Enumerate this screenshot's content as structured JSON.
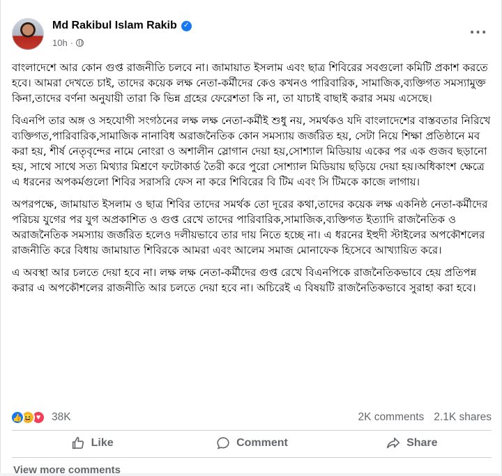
{
  "post": {
    "author_name": "Md Rakibul Islam Rakib",
    "timestamp": "10h",
    "audience_icon": "globe-icon",
    "verified_icon": "verified-badge-icon",
    "more_icon": "more-options-icon",
    "paragraphs": [
      "বাংলাদেশে আর কোন গুপ্ত রাজনীতি চলবে না। জামায়াত ইসলাম এবং ছাত্র শিবিরের সবগুলো কমিটি প্রকাশ করতে হবে। আমরা দেখতে চাই, তাদের কয়েক লক্ষ নেতা-কর্মীদের কেও কখনও পারিবারিক, সামাজিক,ব্যক্তিগত সমস্যামুক্ত কিনা,তাদের বর্ণনা অনুযায়ী তারা কি ভিন্ন গ্রহের ফেরেশতা কি না, তা যাচাই বাছাই করার সময় এসেছে।",
      "বিএনপি তার অঙ্গ ও সহযোগী সংগঠনের লক্ষ লক্ষ নেতা-কর্মীই শুধু নয়, সমর্থকও যদি বাংলাদেশের বাস্তবতার নিরিখে ব্যক্তিগত,পারিবারিক,সামাজিক নানাবিধ অরাজনৈতিক কোন সমস্যায় জর্জরিত হয়, সেটা নিয়ে শিক্ষা প্রতিষ্ঠানে মব করা হয়, শীর্ষ নেতৃবৃন্দের নামে নোংরা ও অশালীন স্লোগান দেয়া হয়,সোশ্যাল মিডিয়ায় একের পর এক গুজব ছড়ানো হয়, সাথে সাথে সত্য মিথ্যার মিশ্রণে ফটোকার্ড তৈরী করে পুরো সোশ্যাল মিডিয়ায় ছড়িয়ে দেয়া হয়।অধিকাংশ ক্ষেত্রে এ ধরনের অপকর্মগুলো শিবির সরাসরি ফেস না করে শিবিরের বি টিম এবং সি টিমকে কাজে লাগায়।",
      "অপরপক্ষে, জামায়াত ইসলাম ও ছাত্র শিবির তাদের সমর্থক তো দূরের কথা,তাদের কয়েক লক্ষ একনিষ্ঠ নেতা-কর্মীদের পরিচয় যুগের পর যুগ অপ্রকাশিত ও গুপ্ত রেখে তাদের পারিবারিক,সামাজিক,ব্যক্তিগত ইত্যাদি রাজনৈতিক ও অরাজনৈতিক সমস্যায় জর্জরিত হলেও দলীয়ভাবে তার দায় নিতে হচ্ছে না। এ ধরনের ইহুদী স্টাইলের অপকৌশলের রাজনীতি করে বিধায় জামায়াত শিবিরকে আমরা এবং আলেম সমাজ মোনাফেক হিসেবে আখ্যায়িত করে।",
      "এ অবস্থা আর চলতে দেয়া হবে না। লক্ষ লক্ষ নেতা-কর্মীদের গুপ্ত রেখে বিএনপিকে রাজনৈতিকভাবে হেয় প্রতিপন্ন করার এ অপকৌশলের রাজনীতি আর চলতে দেয়া হবে না। অচিরেই এ বিষয়টি রাজনৈতিকভাবে সুরাহা করা হবে।"
    ]
  },
  "stats": {
    "reaction_icons": [
      "like-reaction-icon",
      "haha-reaction-icon",
      "love-reaction-icon"
    ],
    "reaction_count": "38K",
    "comments": "2K comments",
    "shares": "2.1K shares"
  },
  "actions": {
    "like_label": "Like",
    "comment_label": "Comment",
    "share_label": "Share"
  },
  "footer": {
    "view_more": "View more comments"
  },
  "colors": {
    "accent": "#1877f2",
    "muted_text": "#65676b",
    "love": "#f33e58",
    "haha": "#f7b125"
  }
}
